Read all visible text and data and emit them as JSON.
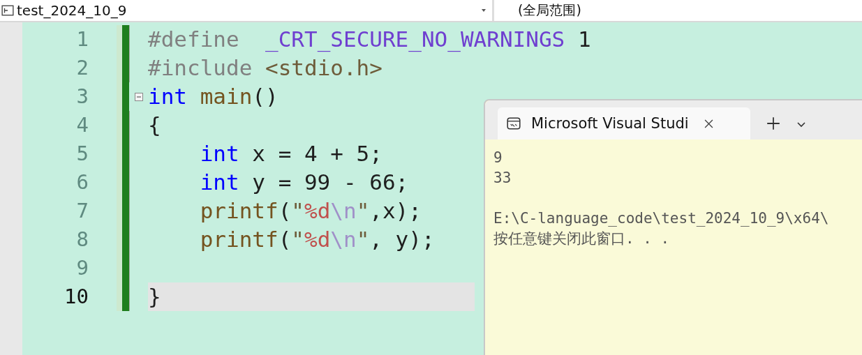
{
  "navigation_bar": {
    "project": "test_2024_10_9",
    "scope": "(全局范围)"
  },
  "editor": {
    "lines": [
      {
        "number": "1",
        "current": false,
        "foldable": false,
        "tokens": [
          {
            "kind": "pre",
            "text": "#define"
          },
          {
            "kind": "macro",
            "text": "  _CRT_SECURE_NO_WARNINGS"
          },
          {
            "kind": "plain",
            "text": " 1"
          }
        ]
      },
      {
        "number": "2",
        "current": false,
        "foldable": false,
        "tokens": [
          {
            "kind": "pre",
            "text": "#include"
          },
          {
            "kind": "str",
            "text": " <stdio.h>"
          }
        ]
      },
      {
        "number": "3",
        "current": false,
        "foldable": true,
        "tokens": [
          {
            "kind": "kw",
            "text": "int"
          },
          {
            "kind": "fn",
            "text": " main"
          },
          {
            "kind": "plain",
            "text": "()"
          }
        ]
      },
      {
        "number": "4",
        "current": false,
        "foldable": false,
        "tokens": [
          {
            "kind": "plain",
            "text": "{"
          }
        ],
        "children": [
          {
            "number": "5",
            "current": false,
            "foldable": false,
            "tokens": [
              {
                "kind": "kw",
                "text": "int"
              },
              {
                "kind": "plain",
                "text": " x = 4 + 5;"
              }
            ]
          },
          {
            "number": "6",
            "current": false,
            "foldable": false,
            "tokens": [
              {
                "kind": "kw",
                "text": "int"
              },
              {
                "kind": "plain",
                "text": " y = 99 - 66;"
              }
            ]
          },
          {
            "number": "7",
            "current": false,
            "foldable": false,
            "tokens": [
              {
                "kind": "fn",
                "text": "printf"
              },
              {
                "kind": "plain",
                "text": "("
              },
              {
                "kind": "str",
                "text": "\""
              },
              {
                "kind": "fmt",
                "text": "%d"
              },
              {
                "kind": "esc",
                "text": "\\n"
              },
              {
                "kind": "str",
                "text": "\""
              },
              {
                "kind": "plain",
                "text": ",x);"
              }
            ]
          },
          {
            "number": "8",
            "current": false,
            "foldable": false,
            "tokens": [
              {
                "kind": "fn",
                "text": "printf"
              },
              {
                "kind": "plain",
                "text": "("
              },
              {
                "kind": "str",
                "text": "\""
              },
              {
                "kind": "fmt",
                "text": "%d"
              },
              {
                "kind": "esc",
                "text": "\\n"
              },
              {
                "kind": "str",
                "text": "\""
              },
              {
                "kind": "plain",
                "text": ", y);"
              }
            ]
          },
          {
            "number": "9",
            "current": false,
            "foldable": false
          }
        ]
      },
      {
        "number": "10",
        "current": true,
        "foldable": false,
        "tokens": [
          {
            "kind": "plain",
            "text": "}"
          }
        ]
      }
    ]
  },
  "console_window": {
    "tabs": [
      {
        "title": "Microsoft Visual Studi",
        "selected": true
      }
    ],
    "output_blocks": [
      {
        "lines": [
          "9",
          "33"
        ]
      },
      {
        "lines": [
          "E:\\C-language_code\\test_2024_10_9\\x64\\",
          "按任意键关闭此窗口. . ."
        ]
      }
    ]
  }
}
